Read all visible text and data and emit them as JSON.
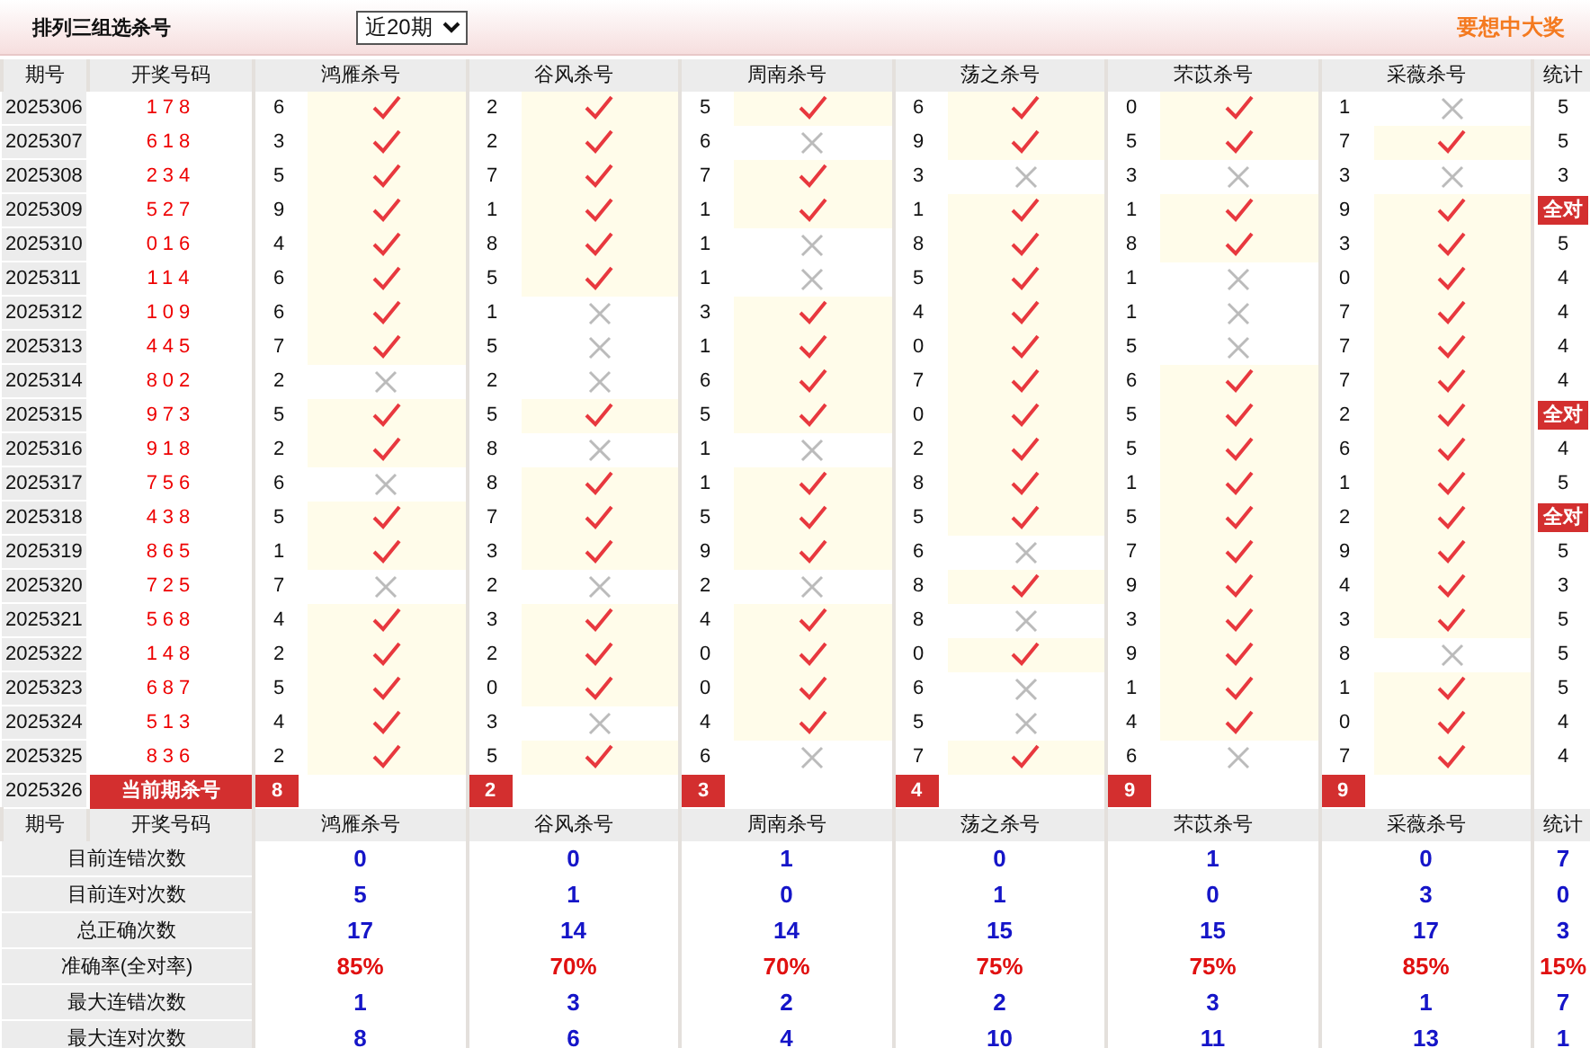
{
  "header": {
    "title": "排列三组选杀号",
    "period_select": {
      "value": "近20期"
    },
    "promo": "要想中大奖"
  },
  "table": {
    "columns": [
      "期号",
      "开奖号码",
      "鸿雁杀号",
      "谷风杀号",
      "周南杀号",
      "荡之杀号",
      "芣苡杀号",
      "采薇杀号",
      "统计"
    ],
    "rows": [
      {
        "period": "2025306",
        "draw": "178",
        "kills": [
          {
            "number": "6",
            "hit": true
          },
          {
            "number": "2",
            "hit": true
          },
          {
            "number": "5",
            "hit": true
          },
          {
            "number": "6",
            "hit": true
          },
          {
            "number": "0",
            "hit": true
          },
          {
            "number": "1",
            "hit": false
          }
        ],
        "stat": {
          "text": "5",
          "all_hit": false
        }
      },
      {
        "period": "2025307",
        "draw": "618",
        "kills": [
          {
            "number": "3",
            "hit": true
          },
          {
            "number": "2",
            "hit": true
          },
          {
            "number": "6",
            "hit": false
          },
          {
            "number": "9",
            "hit": true
          },
          {
            "number": "5",
            "hit": true
          },
          {
            "number": "7",
            "hit": true
          }
        ],
        "stat": {
          "text": "5",
          "all_hit": false
        }
      },
      {
        "period": "2025308",
        "draw": "234",
        "kills": [
          {
            "number": "5",
            "hit": true
          },
          {
            "number": "7",
            "hit": true
          },
          {
            "number": "7",
            "hit": true
          },
          {
            "number": "3",
            "hit": false
          },
          {
            "number": "3",
            "hit": false
          },
          {
            "number": "3",
            "hit": false
          }
        ],
        "stat": {
          "text": "3",
          "all_hit": false
        }
      },
      {
        "period": "2025309",
        "draw": "527",
        "kills": [
          {
            "number": "9",
            "hit": true
          },
          {
            "number": "1",
            "hit": true
          },
          {
            "number": "1",
            "hit": true
          },
          {
            "number": "1",
            "hit": true
          },
          {
            "number": "1",
            "hit": true
          },
          {
            "number": "9",
            "hit": true
          }
        ],
        "stat": {
          "text": "全对",
          "all_hit": true
        }
      },
      {
        "period": "2025310",
        "draw": "016",
        "kills": [
          {
            "number": "4",
            "hit": true
          },
          {
            "number": "8",
            "hit": true
          },
          {
            "number": "1",
            "hit": false
          },
          {
            "number": "8",
            "hit": true
          },
          {
            "number": "8",
            "hit": true
          },
          {
            "number": "3",
            "hit": true
          }
        ],
        "stat": {
          "text": "5",
          "all_hit": false
        }
      },
      {
        "period": "2025311",
        "draw": "114",
        "kills": [
          {
            "number": "6",
            "hit": true
          },
          {
            "number": "5",
            "hit": true
          },
          {
            "number": "1",
            "hit": false
          },
          {
            "number": "5",
            "hit": true
          },
          {
            "number": "1",
            "hit": false
          },
          {
            "number": "0",
            "hit": true
          }
        ],
        "stat": {
          "text": "4",
          "all_hit": false
        }
      },
      {
        "period": "2025312",
        "draw": "109",
        "kills": [
          {
            "number": "6",
            "hit": true
          },
          {
            "number": "1",
            "hit": false
          },
          {
            "number": "3",
            "hit": true
          },
          {
            "number": "4",
            "hit": true
          },
          {
            "number": "1",
            "hit": false
          },
          {
            "number": "7",
            "hit": true
          }
        ],
        "stat": {
          "text": "4",
          "all_hit": false
        }
      },
      {
        "period": "2025313",
        "draw": "445",
        "kills": [
          {
            "number": "7",
            "hit": true
          },
          {
            "number": "5",
            "hit": false
          },
          {
            "number": "1",
            "hit": true
          },
          {
            "number": "0",
            "hit": true
          },
          {
            "number": "5",
            "hit": false
          },
          {
            "number": "7",
            "hit": true
          }
        ],
        "stat": {
          "text": "4",
          "all_hit": false
        }
      },
      {
        "period": "2025314",
        "draw": "802",
        "kills": [
          {
            "number": "2",
            "hit": false
          },
          {
            "number": "2",
            "hit": false
          },
          {
            "number": "6",
            "hit": true
          },
          {
            "number": "7",
            "hit": true
          },
          {
            "number": "6",
            "hit": true
          },
          {
            "number": "7",
            "hit": true
          }
        ],
        "stat": {
          "text": "4",
          "all_hit": false
        }
      },
      {
        "period": "2025315",
        "draw": "973",
        "kills": [
          {
            "number": "5",
            "hit": true
          },
          {
            "number": "5",
            "hit": true
          },
          {
            "number": "5",
            "hit": true
          },
          {
            "number": "0",
            "hit": true
          },
          {
            "number": "5",
            "hit": true
          },
          {
            "number": "2",
            "hit": true
          }
        ],
        "stat": {
          "text": "全对",
          "all_hit": true
        }
      },
      {
        "period": "2025316",
        "draw": "918",
        "kills": [
          {
            "number": "2",
            "hit": true
          },
          {
            "number": "8",
            "hit": false
          },
          {
            "number": "1",
            "hit": false
          },
          {
            "number": "2",
            "hit": true
          },
          {
            "number": "5",
            "hit": true
          },
          {
            "number": "6",
            "hit": true
          }
        ],
        "stat": {
          "text": "4",
          "all_hit": false
        }
      },
      {
        "period": "2025317",
        "draw": "756",
        "kills": [
          {
            "number": "6",
            "hit": false
          },
          {
            "number": "8",
            "hit": true
          },
          {
            "number": "1",
            "hit": true
          },
          {
            "number": "8",
            "hit": true
          },
          {
            "number": "1",
            "hit": true
          },
          {
            "number": "1",
            "hit": true
          }
        ],
        "stat": {
          "text": "5",
          "all_hit": false
        }
      },
      {
        "period": "2025318",
        "draw": "438",
        "kills": [
          {
            "number": "5",
            "hit": true
          },
          {
            "number": "7",
            "hit": true
          },
          {
            "number": "5",
            "hit": true
          },
          {
            "number": "5",
            "hit": true
          },
          {
            "number": "5",
            "hit": true
          },
          {
            "number": "2",
            "hit": true
          }
        ],
        "stat": {
          "text": "全对",
          "all_hit": true
        }
      },
      {
        "period": "2025319",
        "draw": "865",
        "kills": [
          {
            "number": "1",
            "hit": true
          },
          {
            "number": "3",
            "hit": true
          },
          {
            "number": "9",
            "hit": true
          },
          {
            "number": "6",
            "hit": false
          },
          {
            "number": "7",
            "hit": true
          },
          {
            "number": "9",
            "hit": true
          }
        ],
        "stat": {
          "text": "5",
          "all_hit": false
        }
      },
      {
        "period": "2025320",
        "draw": "725",
        "kills": [
          {
            "number": "7",
            "hit": false
          },
          {
            "number": "2",
            "hit": false
          },
          {
            "number": "2",
            "hit": false
          },
          {
            "number": "8",
            "hit": true
          },
          {
            "number": "9",
            "hit": true
          },
          {
            "number": "4",
            "hit": true
          }
        ],
        "stat": {
          "text": "3",
          "all_hit": false
        }
      },
      {
        "period": "2025321",
        "draw": "568",
        "kills": [
          {
            "number": "4",
            "hit": true
          },
          {
            "number": "3",
            "hit": true
          },
          {
            "number": "4",
            "hit": true
          },
          {
            "number": "8",
            "hit": false
          },
          {
            "number": "3",
            "hit": true
          },
          {
            "number": "3",
            "hit": true
          }
        ],
        "stat": {
          "text": "5",
          "all_hit": false
        }
      },
      {
        "period": "2025322",
        "draw": "148",
        "kills": [
          {
            "number": "2",
            "hit": true
          },
          {
            "number": "2",
            "hit": true
          },
          {
            "number": "0",
            "hit": true
          },
          {
            "number": "0",
            "hit": true
          },
          {
            "number": "9",
            "hit": true
          },
          {
            "number": "8",
            "hit": false
          }
        ],
        "stat": {
          "text": "5",
          "all_hit": false
        }
      },
      {
        "period": "2025323",
        "draw": "687",
        "kills": [
          {
            "number": "5",
            "hit": true
          },
          {
            "number": "0",
            "hit": true
          },
          {
            "number": "0",
            "hit": true
          },
          {
            "number": "6",
            "hit": false
          },
          {
            "number": "1",
            "hit": true
          },
          {
            "number": "1",
            "hit": true
          }
        ],
        "stat": {
          "text": "5",
          "all_hit": false
        }
      },
      {
        "period": "2025324",
        "draw": "513",
        "kills": [
          {
            "number": "4",
            "hit": true
          },
          {
            "number": "3",
            "hit": false
          },
          {
            "number": "4",
            "hit": true
          },
          {
            "number": "5",
            "hit": false
          },
          {
            "number": "4",
            "hit": true
          },
          {
            "number": "0",
            "hit": true
          }
        ],
        "stat": {
          "text": "4",
          "all_hit": false
        }
      },
      {
        "period": "2025325",
        "draw": "836",
        "kills": [
          {
            "number": "2",
            "hit": true
          },
          {
            "number": "5",
            "hit": true
          },
          {
            "number": "6",
            "hit": false
          },
          {
            "number": "7",
            "hit": true
          },
          {
            "number": "6",
            "hit": false
          },
          {
            "number": "7",
            "hit": true
          }
        ],
        "stat": {
          "text": "4",
          "all_hit": false
        }
      }
    ],
    "current": {
      "period": "2025326",
      "label": "当前期杀号",
      "kills": [
        "8",
        "2",
        "3",
        "4",
        "9",
        "9"
      ]
    }
  },
  "summary": {
    "columns": [
      "期号",
      "开奖号码",
      "鸿雁杀号",
      "谷风杀号",
      "周南杀号",
      "荡之杀号",
      "芣苡杀号",
      "采薇杀号",
      "统计"
    ],
    "rows": [
      {
        "label": "目前连错次数",
        "kind": "count",
        "values": [
          "0",
          "0",
          "1",
          "0",
          "1",
          "0",
          "7"
        ]
      },
      {
        "label": "目前连对次数",
        "kind": "count",
        "values": [
          "5",
          "1",
          "0",
          "1",
          "0",
          "3",
          "0"
        ]
      },
      {
        "label": "总正确次数",
        "kind": "count",
        "values": [
          "17",
          "14",
          "14",
          "15",
          "15",
          "17",
          "3"
        ]
      },
      {
        "label": "准确率(全对率)",
        "kind": "rate",
        "values": [
          "85%",
          "70%",
          "70%",
          "75%",
          "75%",
          "85%",
          "15%"
        ]
      },
      {
        "label": "最大连错次数",
        "kind": "count",
        "values": [
          "1",
          "3",
          "2",
          "2",
          "3",
          "1",
          "7"
        ]
      },
      {
        "label": "最大连对次数",
        "kind": "count",
        "values": [
          "8",
          "6",
          "4",
          "10",
          "11",
          "13",
          "1"
        ]
      }
    ]
  }
}
